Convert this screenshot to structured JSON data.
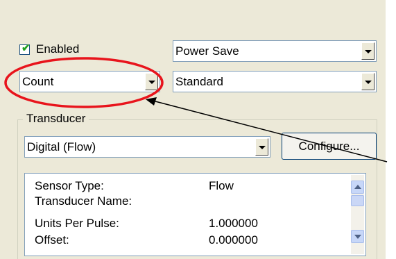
{
  "enabled": {
    "label": "Enabled",
    "checked": true
  },
  "combos": {
    "power": {
      "value": "Power Save"
    },
    "count": {
      "value": "Count"
    },
    "standard": {
      "value": "Standard"
    },
    "transducer_type": {
      "value": "Digital (Flow)"
    }
  },
  "transducer_group": {
    "label": "Transducer",
    "configure_label": "Configure..."
  },
  "properties": {
    "rows": [
      {
        "key": "Sensor Type:",
        "value": "Flow"
      },
      {
        "key": "Transducer Name:",
        "value": ""
      },
      {
        "key": "Units Per Pulse:",
        "value": "1.000000"
      },
      {
        "key": "Offset:",
        "value": "0.000000"
      }
    ]
  },
  "annotation": {
    "ellipse_color": "#e8141c",
    "arrow_color": "#000000"
  }
}
